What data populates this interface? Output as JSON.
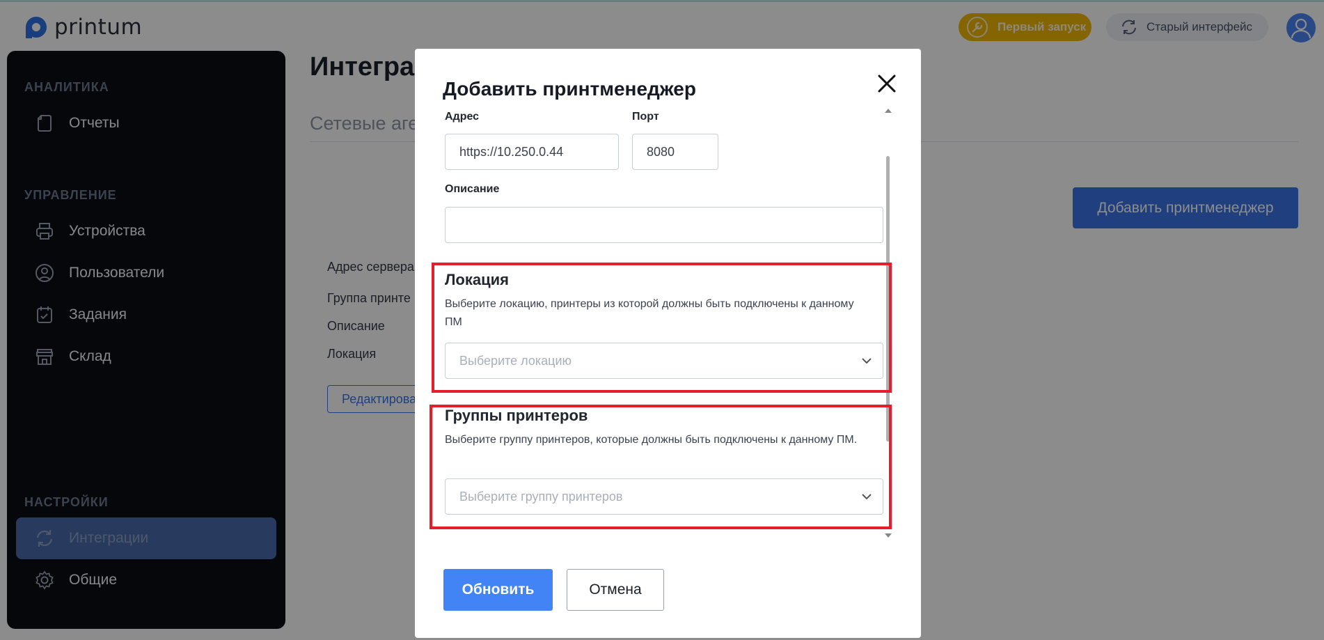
{
  "app": {
    "logo_text": "printum",
    "brand_color": "#2f6fe4"
  },
  "header": {
    "first_launch_label": "Первый запуск",
    "old_ui_label": "Старый интерфейс"
  },
  "sidebar": {
    "sections": [
      {
        "title": "АНАЛИТИКА",
        "items": [
          {
            "label": "Отчеты",
            "icon": "document-icon"
          }
        ]
      },
      {
        "title": "УПРАВЛЕНИЕ",
        "items": [
          {
            "label": "Устройства",
            "icon": "printer-icon"
          },
          {
            "label": "Пользователи",
            "icon": "user-circle-icon"
          },
          {
            "label": "Задания",
            "icon": "calendar-check-icon"
          },
          {
            "label": "Склад",
            "icon": "store-icon"
          }
        ]
      },
      {
        "title": "НАСТРОЙКИ",
        "items": [
          {
            "label": "Интеграции",
            "icon": "sync-icon",
            "active": true
          },
          {
            "label": "Общие",
            "icon": "gear-icon"
          }
        ]
      }
    ]
  },
  "main": {
    "title": "Интеграц",
    "tab_label": "Сетевые аге",
    "add_button_label": "Добавить принтменеджер",
    "info": {
      "server_address_label": "Адрес сервера",
      "printer_group_label": "Группа принте",
      "description_label": "Описание",
      "location_label": "Локация"
    },
    "edit_button_label": "Редактирова"
  },
  "modal": {
    "title": "Добавить принтменеджер",
    "address": {
      "label": "Адрес",
      "value": "https://10.250.0.44"
    },
    "port": {
      "label": "Порт",
      "value": "8080"
    },
    "description": {
      "label": "Описание",
      "value": ""
    },
    "location": {
      "heading": "Локация",
      "description": "Выберите локацию, принтеры из которой должны быть подключены к данному ПМ",
      "placeholder": "Выберите локацию"
    },
    "printer_groups": {
      "heading": "Группы принтеров",
      "description": "Выберите группу принтеров, которые должны быть подключены к данному ПМ.",
      "placeholder": "Выберите группу принтеров"
    },
    "update_button_label": "Обновить",
    "cancel_button_label": "Отмена",
    "highlight_color": "#e41e2b"
  }
}
